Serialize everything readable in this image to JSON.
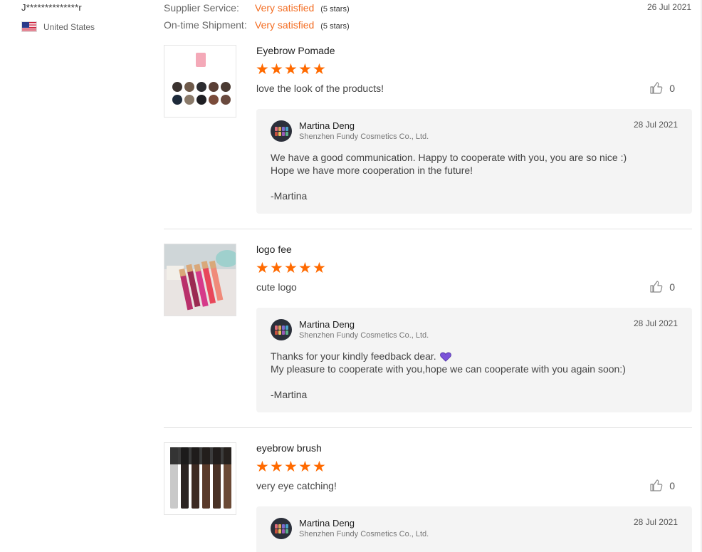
{
  "reviewer": {
    "name": "J**************r",
    "country": "United States"
  },
  "ratings": [
    {
      "label": "Supplier Service:",
      "value": "Very satisfied",
      "stars": "(5 stars)"
    },
    {
      "label": "On-time Shipment:",
      "value": "Very satisfied",
      "stars": "(5 stars)"
    }
  ],
  "review_date": "26 Jul 2021",
  "reviews": [
    {
      "product": "Eyebrow Pomade",
      "rating": 5,
      "comment": "love the look of the products!",
      "likes": "0",
      "reply": {
        "seller": "Martina Deng",
        "company": "Shenzhen Fundy Cosmetics Co., Ltd.",
        "date": "28 Jul 2021",
        "line1": "We have a good communication. Happy to cooperate with you, you are so nice :)",
        "line2": "Hope we have more cooperation in the future!",
        "signature": "-Martina"
      }
    },
    {
      "product": "logo fee",
      "rating": 5,
      "comment": "cute logo",
      "likes": "0",
      "reply": {
        "seller": "Martina Deng",
        "company": "Shenzhen Fundy Cosmetics Co., Ltd.",
        "date": "28 Jul 2021",
        "line1": "Thanks for your kindly feedback dear.",
        "line2": "My pleasure to cooperate with you,hope we can cooperate with you again soon:)",
        "signature": "-Martina"
      }
    },
    {
      "product": "eyebrow brush",
      "rating": 5,
      "comment": "very eye catching!",
      "likes": "0",
      "reply": {
        "seller": "Martina Deng",
        "company": "Shenzhen Fundy Cosmetics Co., Ltd.",
        "date": "28 Jul 2021"
      }
    }
  ],
  "colors": {
    "accent": "#ff6a00",
    "heart": "#7b52d9",
    "reply_bg": "#f4f4f4"
  },
  "icons": [
    "us-flag-icon",
    "star-icon",
    "thumbs-up-icon",
    "heart-emoji-icon"
  ]
}
